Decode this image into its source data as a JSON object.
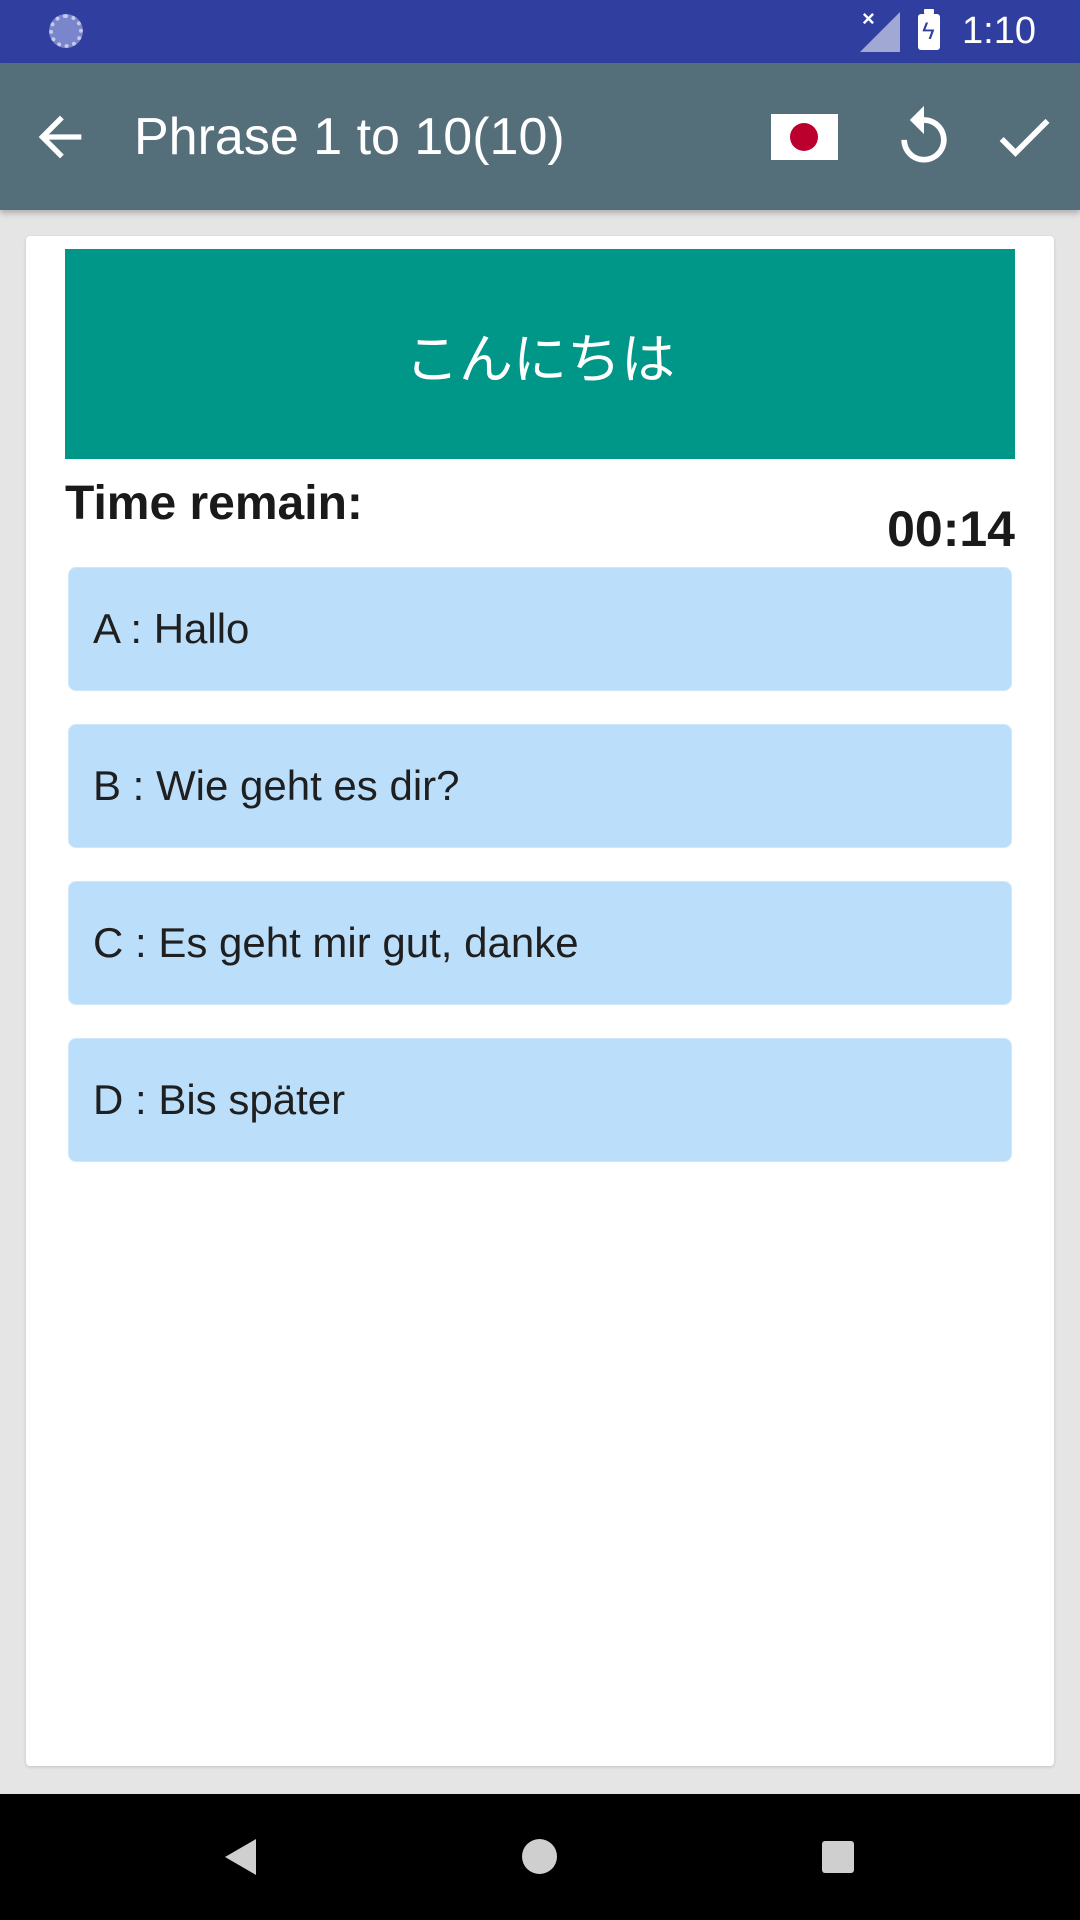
{
  "status_bar": {
    "time": "1:10",
    "icons": [
      "sync-icon",
      "signal-icon",
      "battery-charging-icon"
    ],
    "background": "#303f9f"
  },
  "app_bar": {
    "title": "Phrase 1 to 10(10)",
    "background": "#546e7a",
    "icons": [
      "back-arrow-icon",
      "japan-flag-icon",
      "reset-icon",
      "check-icon"
    ]
  },
  "quiz": {
    "question": "こんにちは",
    "question_background": "#009688",
    "timer_label": "Time remain:",
    "timer_value": "00:14",
    "option_background": "#bbdefb",
    "options": [
      {
        "label": "A : Hallo"
      },
      {
        "label": "B : Wie geht es dir?"
      },
      {
        "label": "C : Es geht mir gut, danke"
      },
      {
        "label": "D : Bis später"
      }
    ]
  },
  "nav_bar": {
    "icons": [
      "nav-back-icon",
      "nav-home-icon",
      "nav-recent-icon"
    ]
  }
}
